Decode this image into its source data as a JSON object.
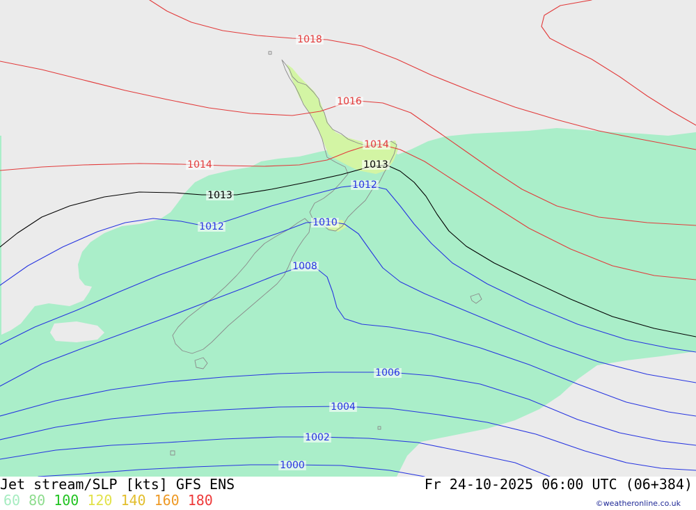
{
  "map": {
    "background_color": "#ebebeb",
    "jet_60_color": "#aaeec9",
    "jet_80_color": "#d3f5a4",
    "land_outline_color": "#8a8a8a"
  },
  "isobars": [
    {
      "label": "1018",
      "color": "#e23a3a"
    },
    {
      "label": "1016",
      "color": "#e23a3a"
    },
    {
      "label": "1014",
      "color": "#e23a3a"
    },
    {
      "label": "1014",
      "color": "#e23a3a"
    },
    {
      "label": "1013",
      "color": "#000000"
    },
    {
      "label": "1013",
      "color": "#000000"
    },
    {
      "label": "1012",
      "color": "#2634e0"
    },
    {
      "label": "1012",
      "color": "#2634e0"
    },
    {
      "label": "1010",
      "color": "#2634e0"
    },
    {
      "label": "1008",
      "color": "#2634e0"
    },
    {
      "label": "1006",
      "color": "#2634e0"
    },
    {
      "label": "1004",
      "color": "#2634e0"
    },
    {
      "label": "1002",
      "color": "#2634e0"
    },
    {
      "label": "1000",
      "color": "#2634e0"
    }
  ],
  "footer": {
    "title": "Jet stream/SLP [kts] GFS ENS",
    "datetime": "Fr 24-10-2025 06:00 UTC (06+384)",
    "legend": [
      {
        "value": "60",
        "color": "#a6ecc0"
      },
      {
        "value": "80",
        "color": "#8edc8e"
      },
      {
        "value": "100",
        "color": "#22c322"
      },
      {
        "value": "120",
        "color": "#e2e24a"
      },
      {
        "value": "140",
        "color": "#e2be2c"
      },
      {
        "value": "160",
        "color": "#ee9a26"
      },
      {
        "value": "180",
        "color": "#ee3a3a"
      }
    ],
    "copyright": "©weatheronline.co.uk",
    "copyright_color": "#1e2896"
  }
}
